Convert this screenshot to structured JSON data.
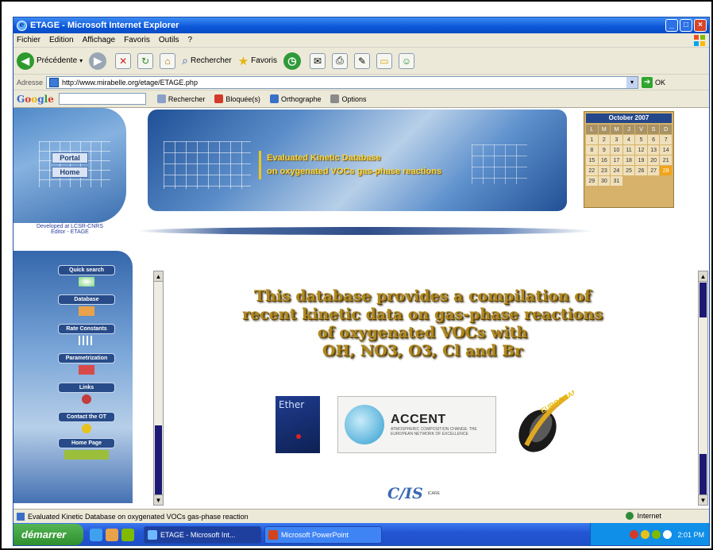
{
  "window": {
    "title": "ETAGE - Microsoft Internet Explorer"
  },
  "menu": [
    "Fichier",
    "Edition",
    "Affichage",
    "Favoris",
    "Outils",
    "?"
  ],
  "toolbar": {
    "back_label": "Précédente",
    "search_label": "Rechercher",
    "favorites_label": "Favoris"
  },
  "address": {
    "label": "Adresse",
    "url": "http://www.mirabelle.org/etage/ETAGE.php",
    "go_label": "OK"
  },
  "googlebar": {
    "brand": "Google",
    "search_btn": "Rechercher",
    "blocked_label": "Bloquée(s)",
    "spell_label": "Orthographe",
    "options_label": "Options"
  },
  "site": {
    "left_nav_buttons": [
      "Portal",
      "Home"
    ],
    "left_link": "Developed at LCSR-CNRS\nEditor - ETAGE",
    "banner_line1": "Evaluated Kinetic Database",
    "banner_line2": "on oxygenated VOCs gas-phase reactions",
    "calendar": {
      "header": "October 2007",
      "weekdays": [
        "L",
        "M",
        "M",
        "J",
        "V",
        "S",
        "D"
      ],
      "days": [
        "1",
        "2",
        "3",
        "4",
        "5",
        "6",
        "7",
        "8",
        "9",
        "10",
        "11",
        "12",
        "13",
        "14",
        "15",
        "16",
        "17",
        "18",
        "19",
        "20",
        "21",
        "22",
        "23",
        "24",
        "25",
        "26",
        "27",
        "28",
        "29",
        "30",
        "31"
      ],
      "selected": "28"
    },
    "nav_items": [
      "Quick search",
      "Database",
      "Rate Constants",
      "Parametrization",
      "Links",
      "Contact the OT",
      "Home Page"
    ],
    "headline_lines": [
      "This database provides a compilation of",
      "recent kinetic data on gas-phase reactions",
      "of oxygenated VOCs with",
      "OH, NO3, O3, Cl and Br"
    ],
    "logos": {
      "ether": "Ether",
      "accent": "ACCENT",
      "accent_sub": "ATMOSPHERIC COMPOSITION CHANGE: THE EUROPEAN NETWORK OF EXCELLENCE",
      "eurochamp": "EUROCHAMP",
      "cnrs": "ICARE"
    }
  },
  "status": {
    "text": "Evaluated Kinetic Database on oxygenated VOCs gas-phase reaction",
    "zone": "Internet"
  },
  "taskbar": {
    "start": "démarrer",
    "tasks": [
      "ETAGE - Microsoft Int...",
      "Microsoft PowerPoint"
    ],
    "clock": "2:01 PM"
  },
  "colors": {
    "headline": "#b0891f",
    "titlebar": "#0b56d8",
    "scroll_thumb": "#1c1a74"
  }
}
